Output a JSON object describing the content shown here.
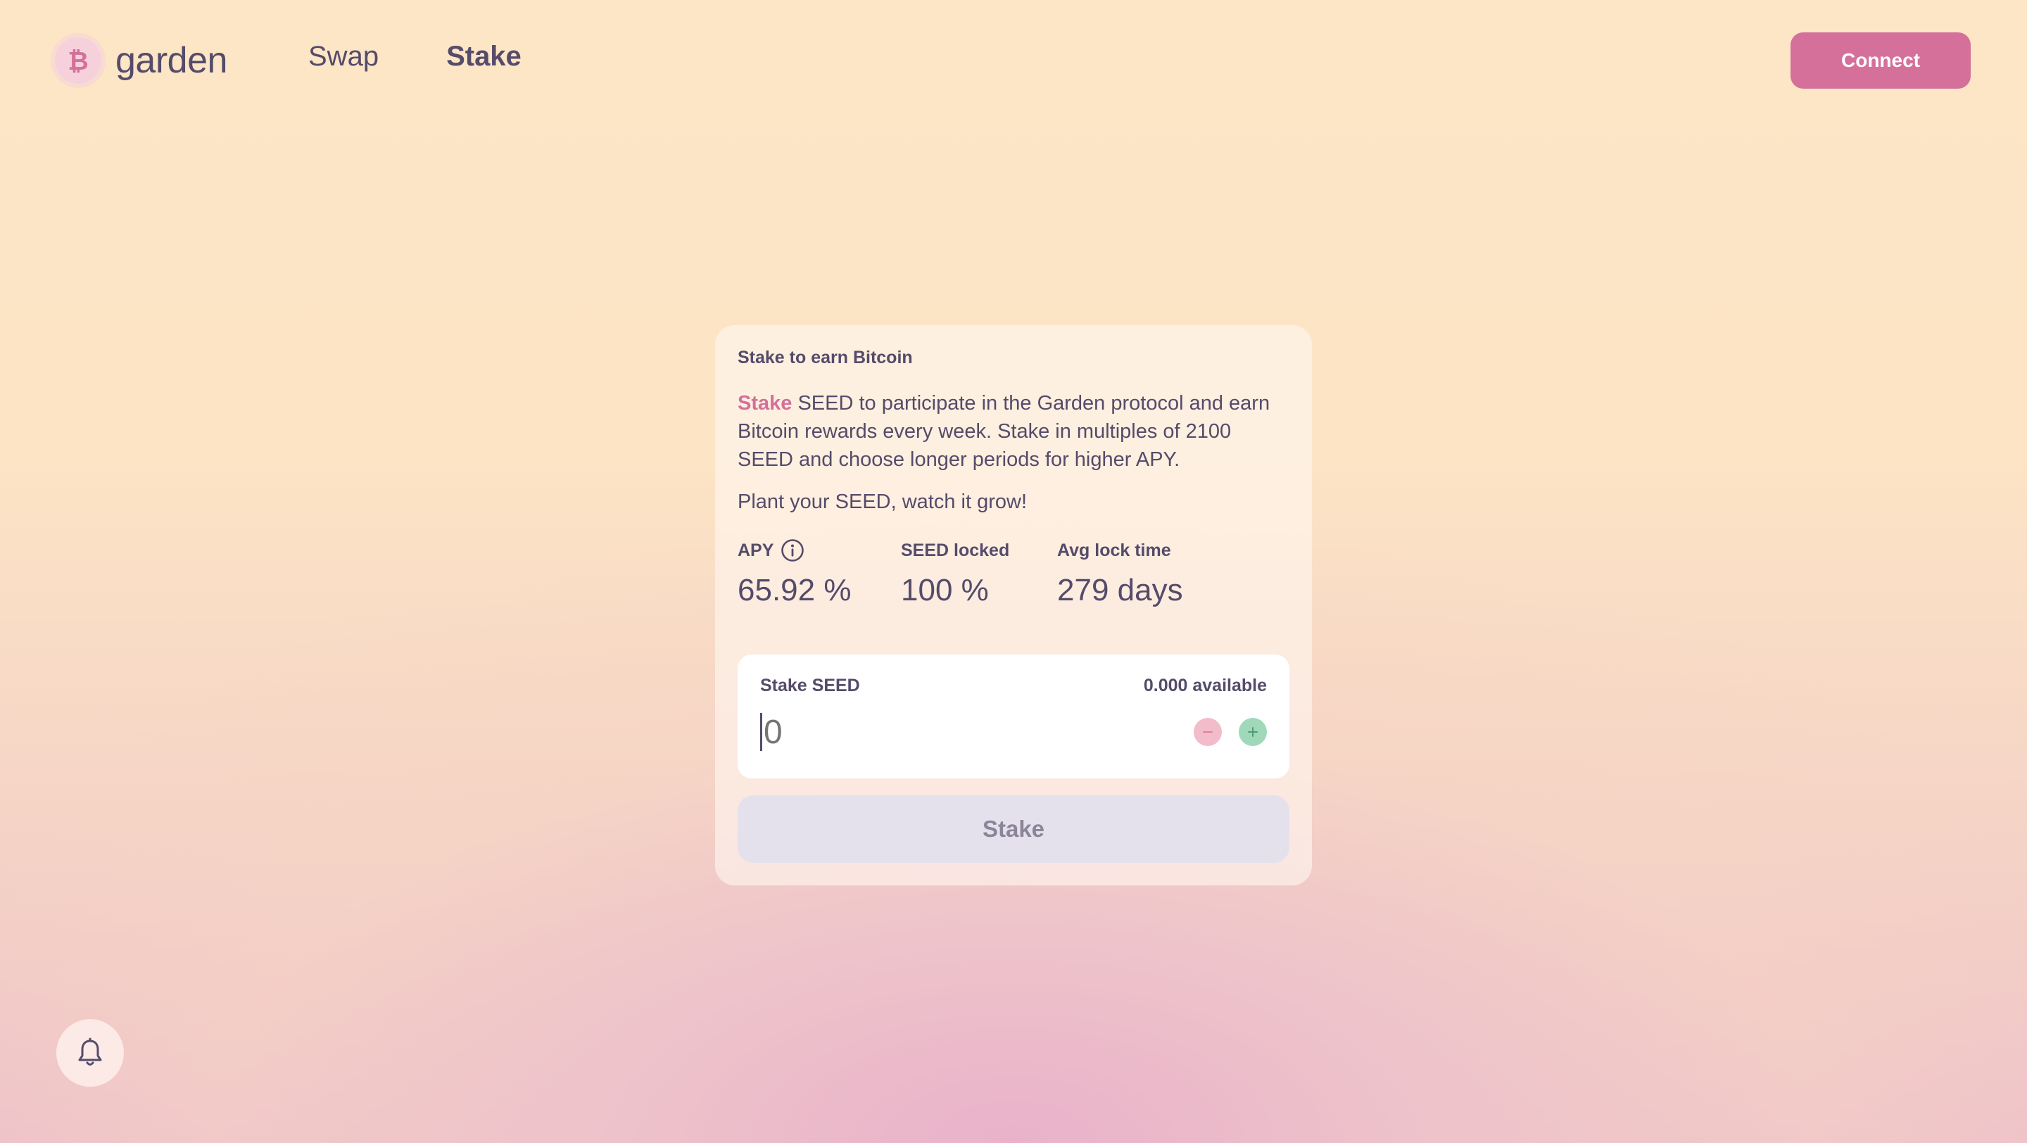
{
  "header": {
    "logo_text": "garden",
    "nav": [
      {
        "label": "Swap",
        "active": false
      },
      {
        "label": "Stake",
        "active": true
      }
    ],
    "connect_label": "Connect"
  },
  "stake_card": {
    "title": "Stake to earn Bitcoin",
    "description_accent": "Stake",
    "description_rest": " SEED to participate in the Garden protocol and earn Bitcoin rewards every week. Stake in multiples of 2100 SEED and choose longer periods for higher APY.",
    "tagline": "Plant your SEED, watch it grow!",
    "stats": [
      {
        "label": "APY",
        "value": "65.92 %"
      },
      {
        "label": "SEED locked",
        "value": "100 %"
      },
      {
        "label": "Avg lock time",
        "value": "279 days"
      }
    ],
    "input": {
      "label": "Stake SEED",
      "available": "0.000 available",
      "placeholder": "0"
    },
    "stake_button_label": "Stake"
  },
  "icons": {
    "logo": "bitcoin-icon",
    "apy_info": "info-icon",
    "decrement": "minus-icon",
    "increment": "plus-icon",
    "notifications": "bell-icon"
  },
  "colors": {
    "accent": "#D4709A",
    "text": "#554B6A",
    "plus": "#9FD9BA",
    "minus": "#F2BCCB"
  }
}
